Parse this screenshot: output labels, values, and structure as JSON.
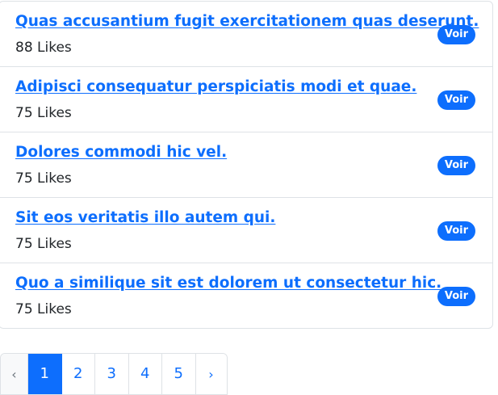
{
  "posts": [
    {
      "title": "Quas accusantium fugit exercitationem quas deserunt.",
      "likes": "88 Likes",
      "action": "Voir"
    },
    {
      "title": "Adipisci consequatur perspiciatis modi et quae.",
      "likes": "75 Likes",
      "action": "Voir"
    },
    {
      "title": "Dolores commodi hic vel.",
      "likes": "75 Likes",
      "action": "Voir"
    },
    {
      "title": "Sit eos veritatis illo autem qui.",
      "likes": "75 Likes",
      "action": "Voir"
    },
    {
      "title": "Quo a similique sit est dolorem ut consectetur hic.",
      "likes": "75 Likes",
      "action": "Voir"
    }
  ],
  "pagination": {
    "prev": "‹",
    "pages": [
      "1",
      "2",
      "3",
      "4",
      "5"
    ],
    "next": "›",
    "active_page": "1"
  },
  "colors": {
    "accent": "#0d6efd",
    "text": "#212529",
    "border": "#dee2e6",
    "muted": "#6c757d"
  }
}
